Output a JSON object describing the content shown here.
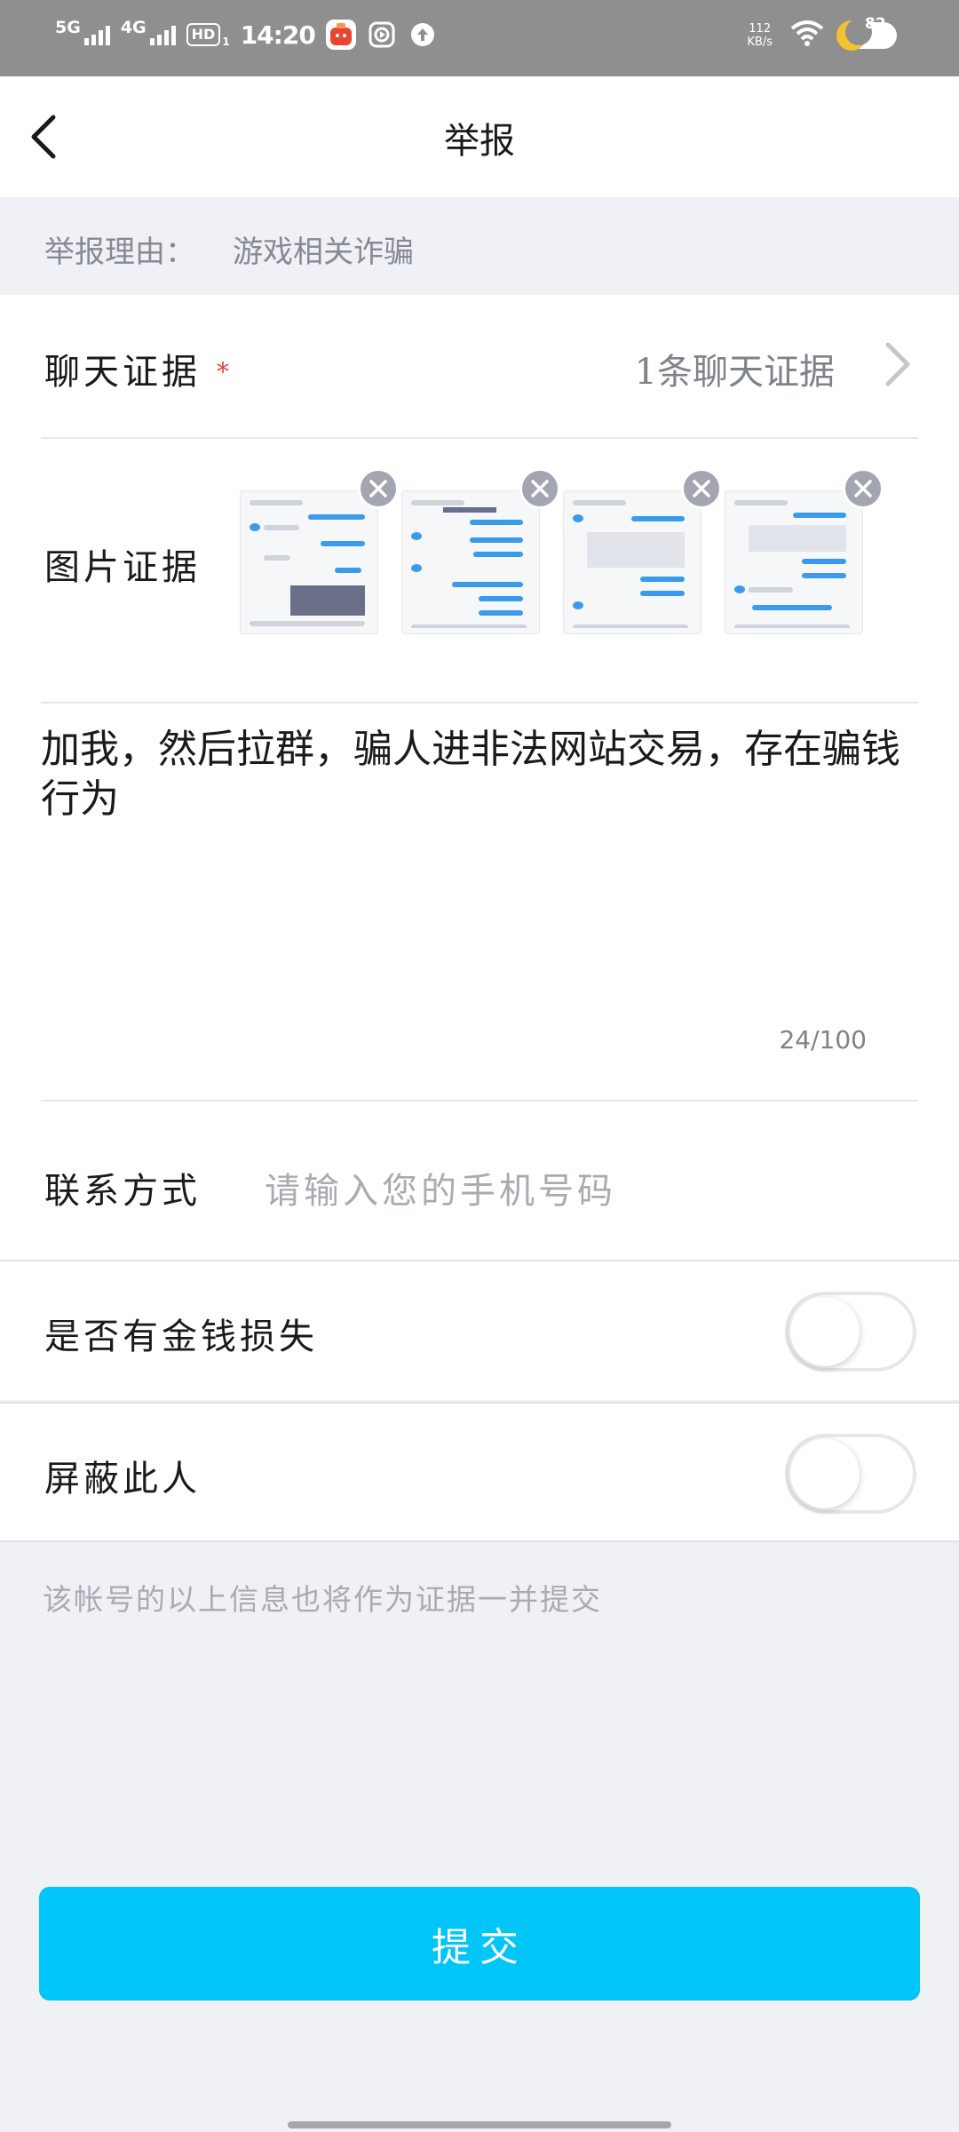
{
  "status_bar": {
    "net1": "5G",
    "net2": "4G",
    "hd": "HD",
    "hd_sub": "1",
    "time": "14:20",
    "speed_value": "112",
    "speed_unit": "KB/s",
    "battery": "82",
    "icons": [
      "app-red-icon",
      "record-icon",
      "upload-icon",
      "wifi-icon",
      "night-moon-icon"
    ]
  },
  "header": {
    "title": "举报",
    "back_icon": "chevron-left-icon"
  },
  "reason": {
    "label": "举报理由：",
    "value": "游戏相关诈骗"
  },
  "chat_evidence": {
    "label": "聊天证据",
    "required_mark": "*",
    "value": "1条聊天证据"
  },
  "image_evidence": {
    "label": "图片证据",
    "images": [
      {
        "name": "screenshot-1"
      },
      {
        "name": "screenshot-2"
      },
      {
        "name": "screenshot-3"
      },
      {
        "name": "screenshot-4"
      }
    ]
  },
  "description": {
    "text": "加我，然后拉群，骗人进非法网站交易，存在骗钱行为",
    "counter": "24/100"
  },
  "contact": {
    "label": "联系方式",
    "placeholder": "请输入您的手机号码"
  },
  "money_loss": {
    "label": "是否有金钱损失",
    "checked": false
  },
  "block_user": {
    "label": "屏蔽此人",
    "checked": false
  },
  "footnote": "该帐号的以上信息也将作为证据一并提交",
  "submit_label": "提交",
  "colors": {
    "accent": "#00c6f7",
    "required": "#e0483a",
    "status_bar": "#8f8f8f"
  }
}
